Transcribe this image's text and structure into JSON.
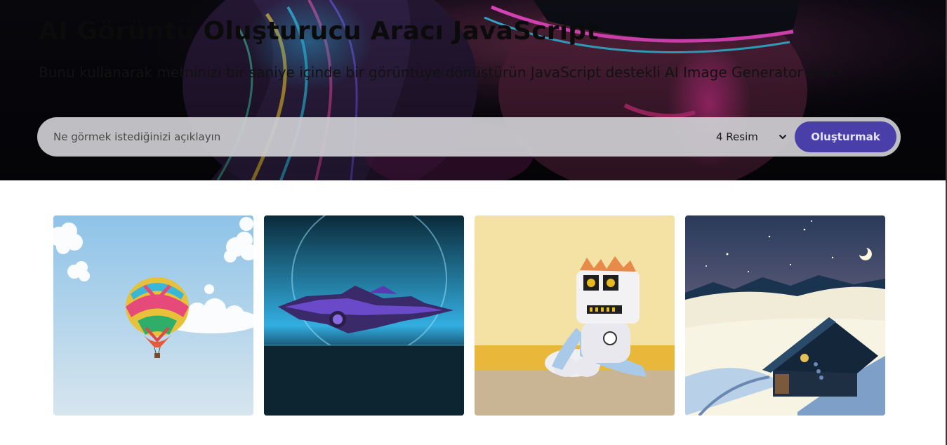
{
  "hero": {
    "title": "AI Görüntü Oluşturucu Aracı JavaScript",
    "subtitle": "Bunu kullanarak metninizi bir saniye içinde bir görüntüye dönüştürün JavaScript destekli AI Image Generator aracı"
  },
  "form": {
    "prompt_placeholder": "Ne görmek istediğinizi açıklayın",
    "prompt_value": "",
    "count_selected": "4 Resim",
    "submit_label": "Oluşturmak"
  },
  "gallery": {
    "images": [
      {
        "subject": "hot-air-balloon"
      },
      {
        "subject": "purple-spaceship"
      },
      {
        "subject": "plush-robot"
      },
      {
        "subject": "snowy-cabin-night"
      }
    ]
  },
  "colors": {
    "accent": "#4a3fa8",
    "form_bg": "#cdcdd2",
    "hero_bg": "#07070d"
  }
}
